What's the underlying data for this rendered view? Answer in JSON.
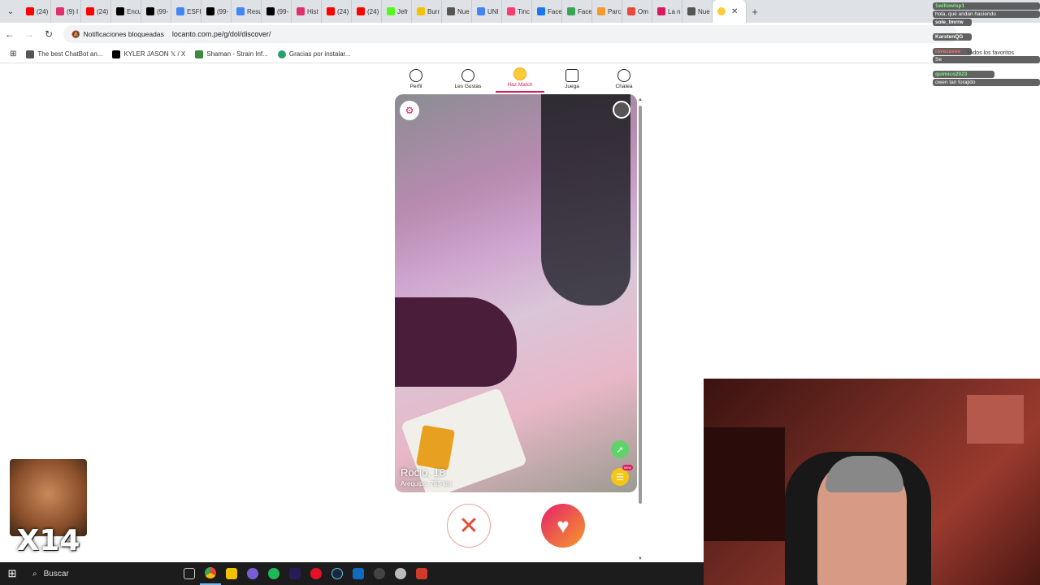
{
  "browser": {
    "tabs": [
      {
        "label": "(24)",
        "icon": "youtube-icon",
        "color": "#ff0000"
      },
      {
        "label": "(9) I",
        "icon": "instagram-icon",
        "color": "#e1306c"
      },
      {
        "label": "(24)",
        "icon": "youtube-icon",
        "color": "#ff0000"
      },
      {
        "label": "Encu",
        "icon": "tiktok-icon",
        "color": "#000000"
      },
      {
        "label": "(99-",
        "icon": "tiktok-icon",
        "color": "#000000"
      },
      {
        "label": "ESFI",
        "icon": "google-icon",
        "color": "#4285f4"
      },
      {
        "label": "(99-",
        "icon": "tiktok-icon",
        "color": "#000000"
      },
      {
        "label": "Resu",
        "icon": "google-icon",
        "color": "#4285f4"
      },
      {
        "label": "(99-",
        "icon": "tiktok-icon",
        "color": "#000000"
      },
      {
        "label": "Hist",
        "icon": "instagram-icon",
        "color": "#e1306c"
      },
      {
        "label": "(24)",
        "icon": "youtube-icon",
        "color": "#ff0000"
      },
      {
        "label": "(24)",
        "icon": "youtube-icon",
        "color": "#ff0000"
      },
      {
        "label": "Jefr",
        "icon": "kick-icon",
        "color": "#53fc18"
      },
      {
        "label": "Burr",
        "icon": "site-icon",
        "color": "#f2c200"
      },
      {
        "label": "Nue",
        "icon": "globe-icon",
        "color": "#555555"
      },
      {
        "label": "UNI",
        "icon": "google-icon",
        "color": "#4285f4"
      },
      {
        "label": "Tinc",
        "icon": "tinder-icon",
        "color": "#fe3c72"
      },
      {
        "label": "Face",
        "icon": "facebook-icon",
        "color": "#1877f2"
      },
      {
        "label": "Face",
        "icon": "play-icon",
        "color": "#34a853"
      },
      {
        "label": "Parc",
        "icon": "site-icon",
        "color": "#f59a2b"
      },
      {
        "label": "Om",
        "icon": "mail-icon",
        "color": "#e84a3a"
      },
      {
        "label": "La n",
        "icon": "site-icon",
        "color": "#d81b60"
      },
      {
        "label": "Nue",
        "icon": "globe-icon",
        "color": "#555555"
      }
    ],
    "active_tab_icon": "hazmatch-icon",
    "address": {
      "notification_chip": "Notificaciones bloqueadas",
      "url": "locanto.com.pe/g/dol/discover/"
    },
    "bookmarks": [
      {
        "label": "The best ChatBot an...",
        "icon": "chatgpt-icon"
      },
      {
        "label": "KYLER JASON 𝕏 / X",
        "icon": "x-icon"
      },
      {
        "label": "Shaman - Strain Inf...",
        "icon": "leaf-icon"
      },
      {
        "label": "Gracias por instalar...",
        "icon": "shield-icon"
      }
    ],
    "bookmarks_right": "Todos los favoritos"
  },
  "app": {
    "nav": [
      {
        "label": "Perfil",
        "icon": "profile-icon"
      },
      {
        "label": "Les Gustas",
        "icon": "heart-icon"
      },
      {
        "label": "Haz Match",
        "icon": "match-icon",
        "active": true
      },
      {
        "label": "Juega",
        "icon": "game-icon"
      },
      {
        "label": "Chatea",
        "icon": "chat-icon"
      }
    ],
    "profile": {
      "name_age": "Rocio, 18",
      "location": "Arequipa, 765 km"
    },
    "new_badge": "NEW",
    "accent": "#d81b60"
  },
  "chat": [
    {
      "user": "1willowisp1",
      "text": "hola, qué andan haciendo"
    },
    {
      "user": "sole_tmrrw",
      "text": ""
    },
    {
      "user": "KarstenQG",
      "text": ""
    },
    {
      "user": "ravezavee",
      "text": "Se"
    },
    {
      "user": "quimico2023",
      "text": "owen tan forajido"
    }
  ],
  "overlay": {
    "multiplier": "X14"
  },
  "taskbar": {
    "search_placeholder": "Buscar"
  }
}
